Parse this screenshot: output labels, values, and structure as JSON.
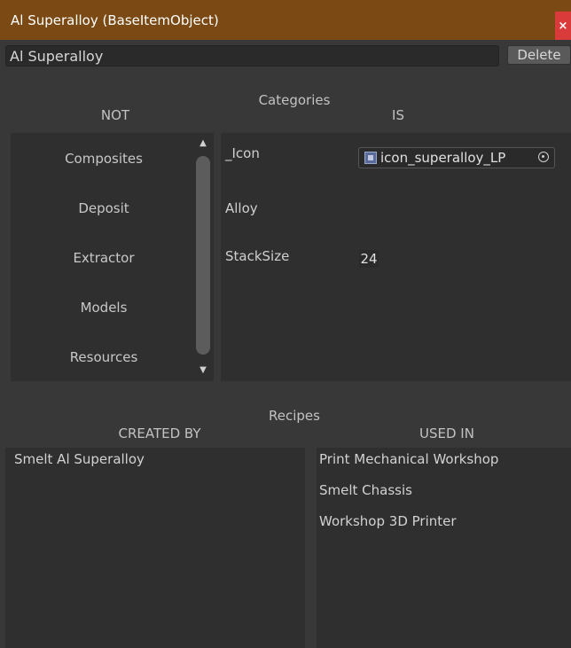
{
  "window": {
    "title": "Al Superalloy (BaseItemObject)",
    "close_label": "×"
  },
  "item": {
    "name_value": "Al Superalloy",
    "delete_label": "Delete"
  },
  "categories": {
    "title": "Categories",
    "not_header": "NOT",
    "is_header": "IS",
    "not_items": [
      "Composites",
      "Deposit",
      "Extractor",
      "Models",
      "Resources"
    ],
    "is_properties": [
      {
        "label": "_Icon",
        "value": "icon_superalloy_LP"
      },
      {
        "label": "Alloy"
      },
      {
        "label": "StackSize",
        "value": "24"
      }
    ]
  },
  "recipes": {
    "title": "Recipes",
    "created_by_header": "CREATED BY",
    "used_in_header": "USED IN",
    "created_by": [
      "Smelt Al Superalloy"
    ],
    "used_in": [
      "Print Mechanical Workshop",
      "Smelt Chassis",
      "Workshop 3D Printer"
    ]
  },
  "colors": {
    "title_bar": "#7b4a14",
    "close_button": "#d93a3a",
    "background": "#383838",
    "panel": "#2f2f2f"
  }
}
